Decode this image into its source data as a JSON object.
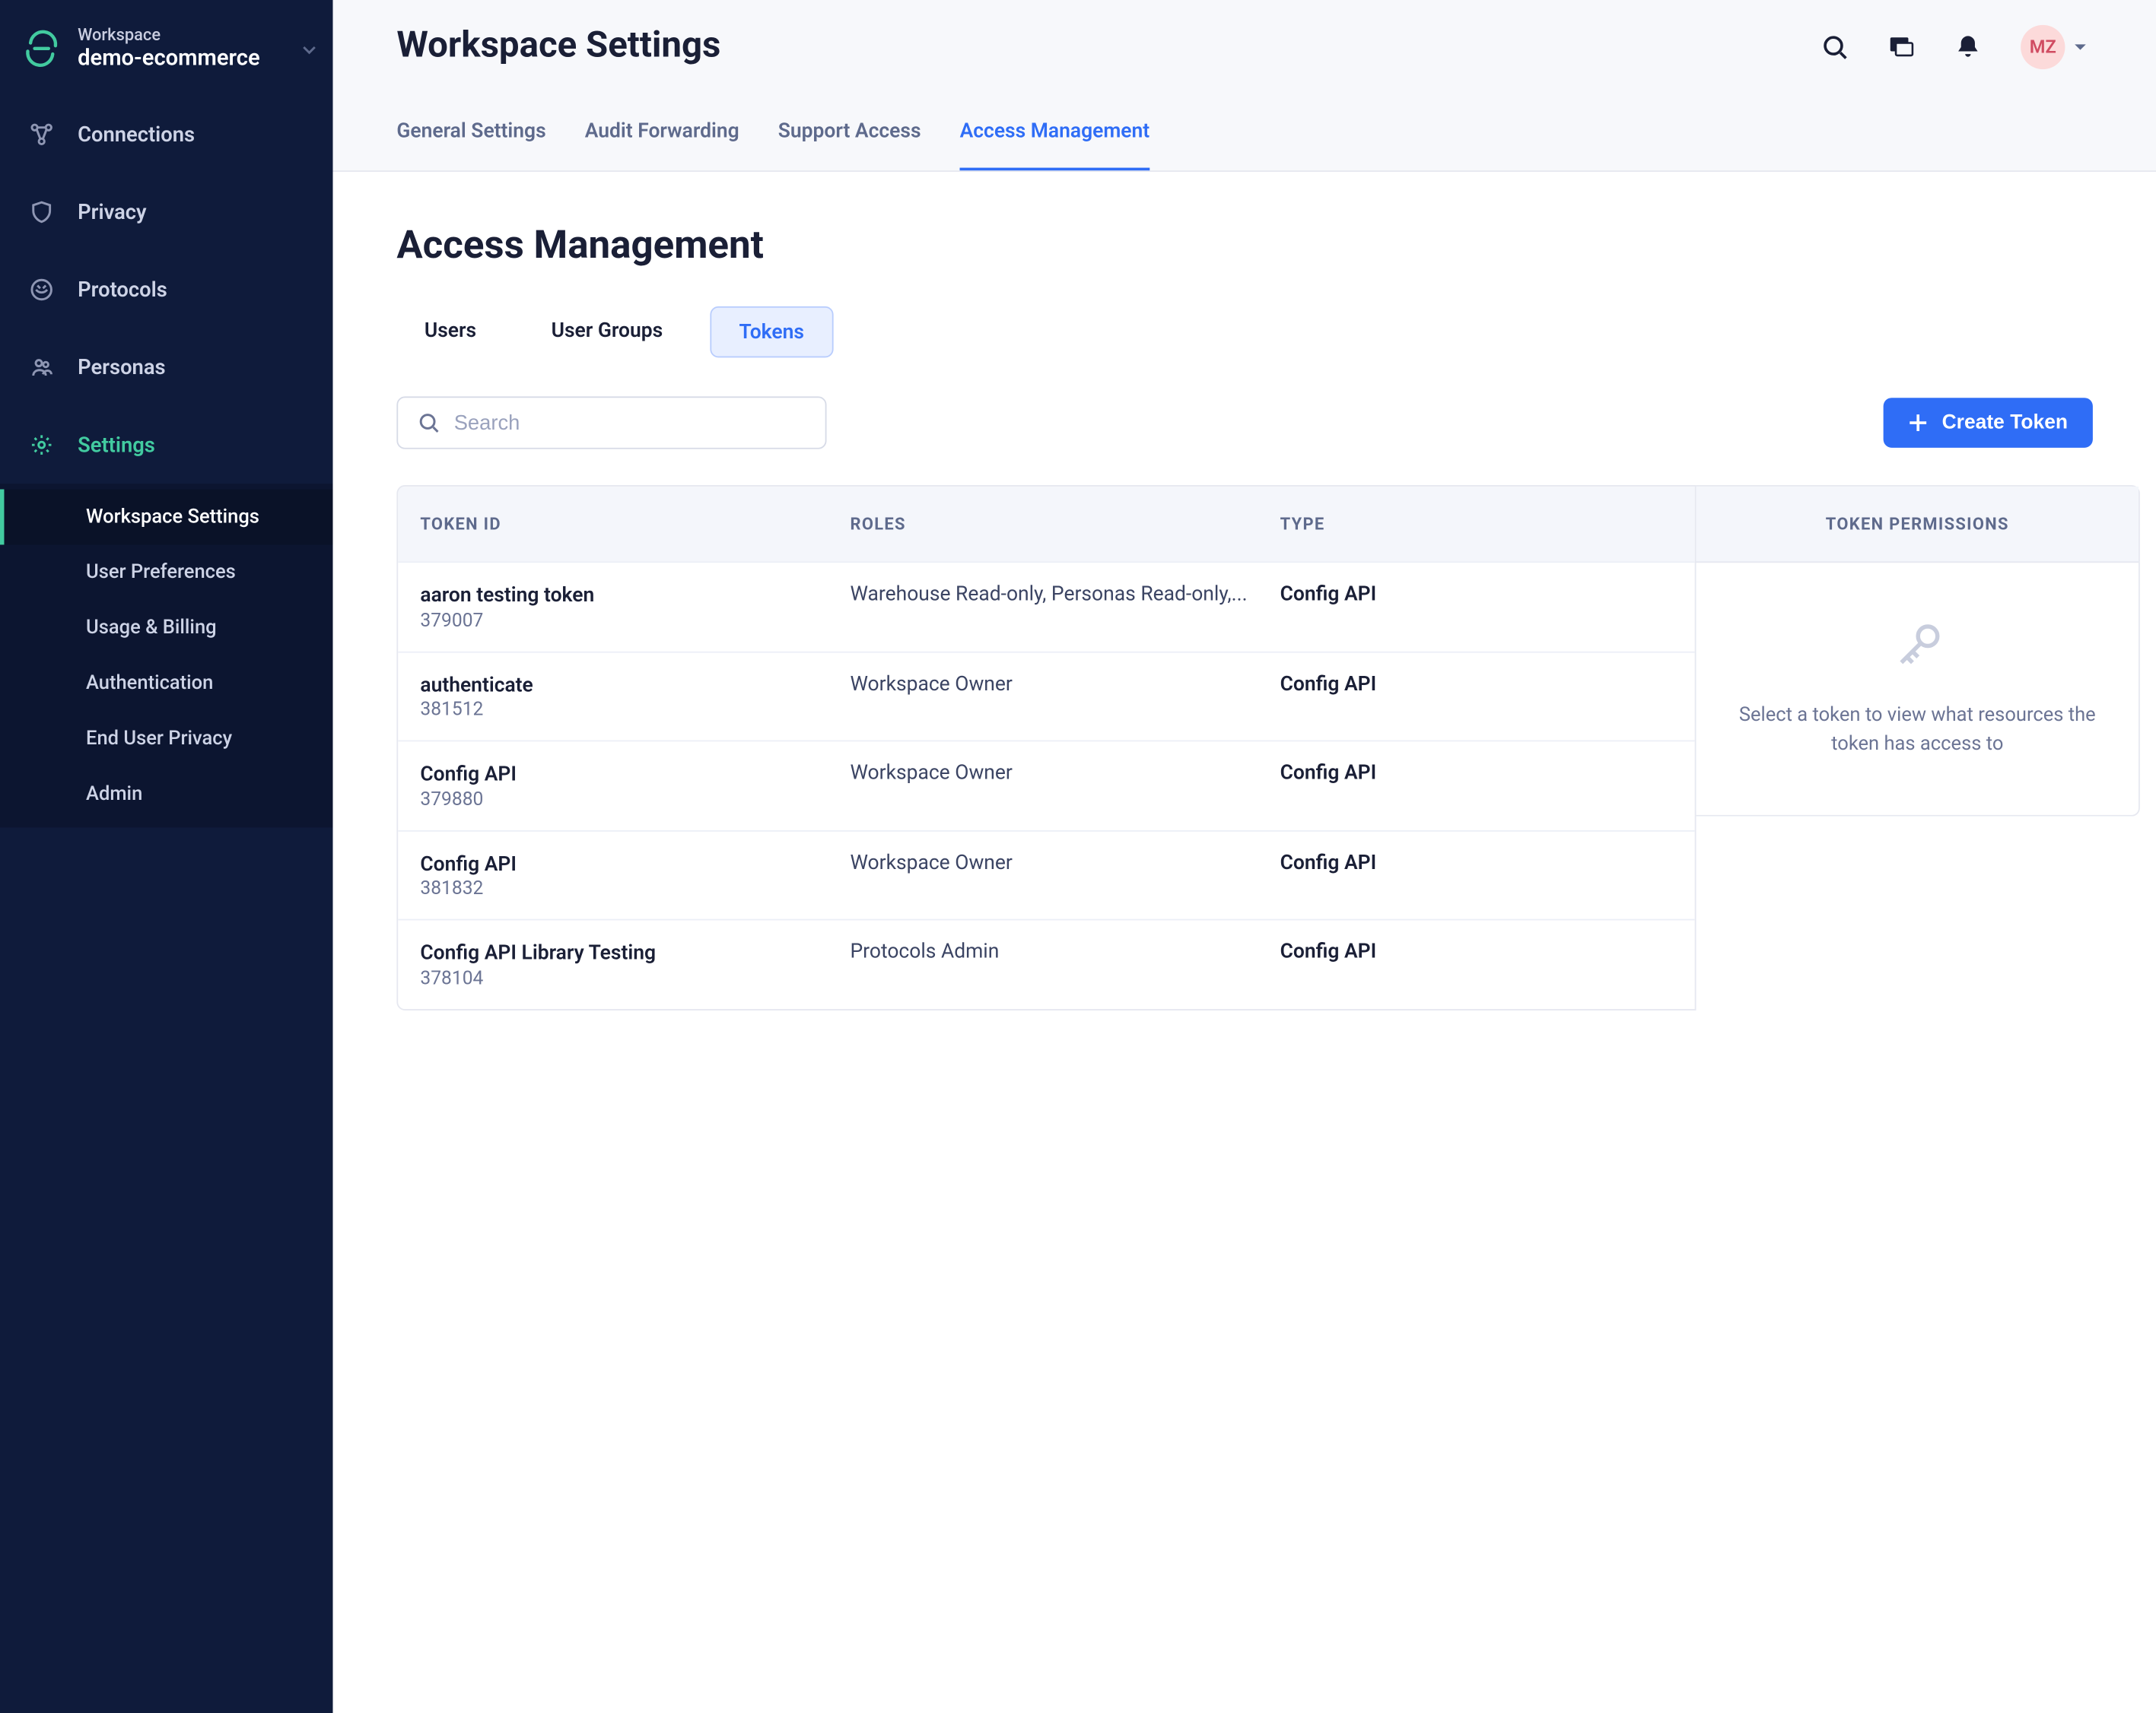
{
  "sidebar": {
    "workspace_label": "Workspace",
    "workspace_name": "demo-ecommerce",
    "items": [
      {
        "label": "Connections"
      },
      {
        "label": "Privacy"
      },
      {
        "label": "Protocols"
      },
      {
        "label": "Personas"
      },
      {
        "label": "Settings"
      }
    ],
    "subitems": [
      {
        "label": "Workspace Settings"
      },
      {
        "label": "User Preferences"
      },
      {
        "label": "Usage & Billing"
      },
      {
        "label": "Authentication"
      },
      {
        "label": "End User Privacy"
      },
      {
        "label": "Admin"
      }
    ]
  },
  "header": {
    "title": "Workspace Settings",
    "avatar_initials": "MZ",
    "tabs": [
      {
        "label": "General Settings"
      },
      {
        "label": "Audit Forwarding"
      },
      {
        "label": "Support Access"
      },
      {
        "label": "Access Management"
      }
    ]
  },
  "content": {
    "section_title": "Access Management",
    "subtabs": [
      {
        "label": "Users"
      },
      {
        "label": "User Groups"
      },
      {
        "label": "Tokens"
      }
    ],
    "search_placeholder": "Search",
    "create_button": "Create Token",
    "table": {
      "columns": [
        "TOKEN ID",
        "ROLES",
        "TYPE"
      ],
      "rows": [
        {
          "name": "aaron testing token",
          "id": "379007",
          "roles": "Warehouse Read-only, Personas Read-only,...",
          "type": "Config API"
        },
        {
          "name": "authenticate",
          "id": "381512",
          "roles": "Workspace Owner",
          "type": "Config API"
        },
        {
          "name": "Config API",
          "id": "379880",
          "roles": "Workspace Owner",
          "type": "Config API"
        },
        {
          "name": "Config API",
          "id": "381832",
          "roles": "Workspace Owner",
          "type": "Config API"
        },
        {
          "name": "Config API Library Testing",
          "id": "378104",
          "roles": "Protocols Admin",
          "type": "Config API"
        }
      ]
    },
    "side_panel": {
      "title": "TOKEN PERMISSIONS",
      "empty_text": "Select a token to view what resources the token has access to"
    }
  }
}
